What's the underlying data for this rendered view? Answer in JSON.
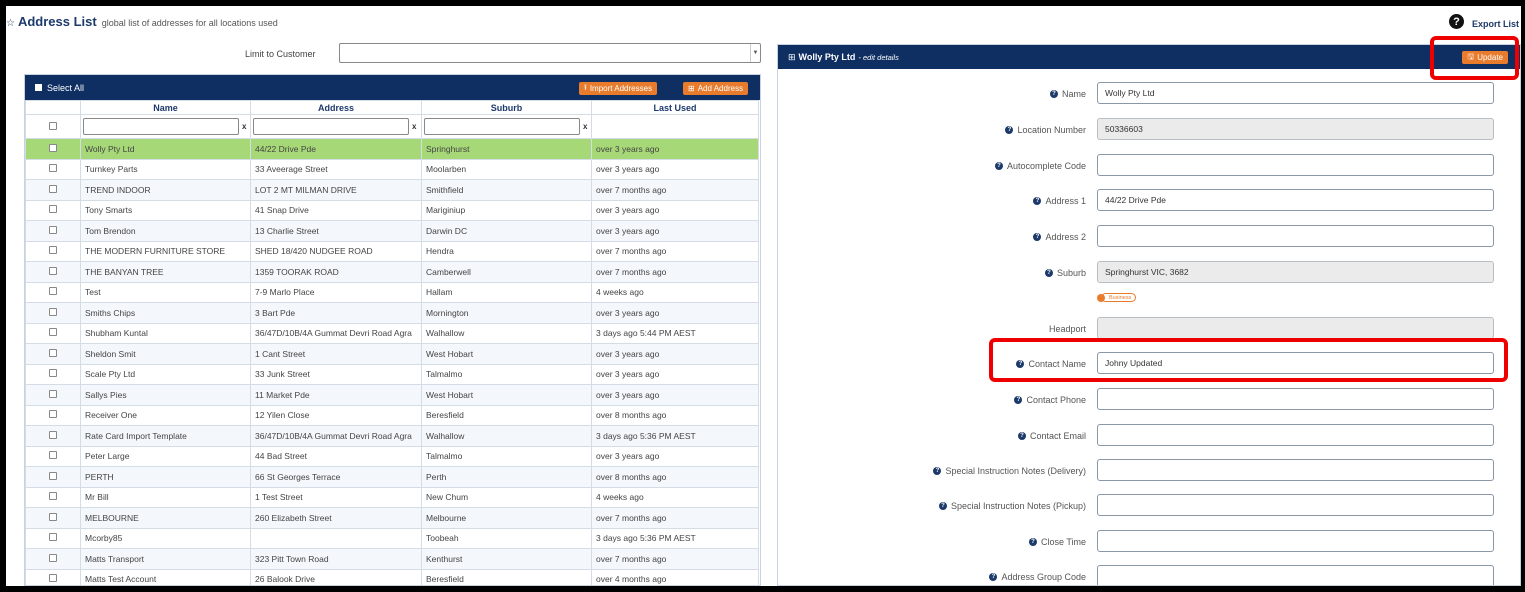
{
  "header": {
    "title": "Address List",
    "subtitle": "global list of addresses for all locations used",
    "export_label": "Export List"
  },
  "limit": {
    "label": "Limit to Customer",
    "value": ""
  },
  "list": {
    "select_all": "Select All",
    "import_label": "Import Addresses",
    "add_label": "Add Address",
    "columns": [
      "Name",
      "Address",
      "Suburb",
      "Last Used"
    ],
    "rows": [
      {
        "name": "Wolly Pty Ltd",
        "address": "44/22 Drive Pde",
        "suburb": "Springhurst",
        "last": "over 3 years ago"
      },
      {
        "name": "Turnkey Parts",
        "address": "33 Aveerage Street",
        "suburb": "Moolarben",
        "last": "over 3 years ago"
      },
      {
        "name": "TREND INDOOR",
        "address": "LOT 2 MT MILMAN DRIVE",
        "suburb": "Smithfield",
        "last": "over 7 months ago"
      },
      {
        "name": "Tony Smarts",
        "address": "41 Snap Drive",
        "suburb": "Mariginiup",
        "last": "over 3 years ago"
      },
      {
        "name": "Tom Brendon",
        "address": "13 Charlie Street",
        "suburb": "Darwin DC",
        "last": "over 3 years ago"
      },
      {
        "name": "THE MODERN FURNITURE STORE",
        "address": "SHED 18/420 NUDGEE ROAD",
        "suburb": "Hendra",
        "last": "over 7 months ago"
      },
      {
        "name": "THE BANYAN TREE",
        "address": "1359 TOORAK ROAD",
        "suburb": "Camberwell",
        "last": "over 7 months ago"
      },
      {
        "name": "Test",
        "address": "7-9 Marlo Place",
        "suburb": "Hallam",
        "last": "4 weeks ago"
      },
      {
        "name": "Smiths Chips",
        "address": "3 Bart Pde",
        "suburb": "Mornington",
        "last": "over 3 years ago"
      },
      {
        "name": "Shubham Kuntal",
        "address": "36/47D/10B/4A Gummat Devri Road Agra",
        "suburb": "Walhallow",
        "last": "3 days ago 5:44 PM AEST"
      },
      {
        "name": "Sheldon Smit",
        "address": "1 Cant Street",
        "suburb": "West Hobart",
        "last": "over 3 years ago"
      },
      {
        "name": "Scale Pty Ltd",
        "address": "33 Junk Street",
        "suburb": "Talmalmo",
        "last": "over 3 years ago"
      },
      {
        "name": "Sallys Pies",
        "address": "11 Market Pde",
        "suburb": "West Hobart",
        "last": "over 3 years ago"
      },
      {
        "name": "Receiver One",
        "address": "12 Yilen Close",
        "suburb": "Beresfield",
        "last": "over 8 months ago"
      },
      {
        "name": "Rate Card Import Template",
        "address": "36/47D/10B/4A Gummat Devri Road Agra",
        "suburb": "Walhallow",
        "last": "3 days ago 5:36 PM AEST"
      },
      {
        "name": "Peter Large",
        "address": "44 Bad Street",
        "suburb": "Talmalmo",
        "last": "over 3 years ago"
      },
      {
        "name": "PERTH",
        "address": "66 St Georges Terrace",
        "suburb": "Perth",
        "last": "over 8 months ago"
      },
      {
        "name": "Mr Bill",
        "address": "1 Test Street",
        "suburb": "New Chum",
        "last": "4 weeks ago"
      },
      {
        "name": "MELBOURNE",
        "address": "260 Elizabeth Street",
        "suburb": "Melbourne",
        "last": "over 7 months ago"
      },
      {
        "name": "Mcorby85",
        "address": "",
        "suburb": "Toobeah",
        "last": "3 days ago 5:36 PM AEST"
      },
      {
        "name": "Matts Transport",
        "address": "323 Pitt Town Road",
        "suburb": "Kenthurst",
        "last": "over 7 months ago"
      },
      {
        "name": "Matts Test Account",
        "address": "26 Balook Drive",
        "suburb": "Beresfield",
        "last": "over 4 months ago"
      }
    ]
  },
  "detail": {
    "title": "Wolly Pty Ltd",
    "subtitle": "- edit details",
    "update_label": "Update",
    "toggle_label": "Business",
    "fields": [
      {
        "label": "Name",
        "value": "Wolly Pty Ltd"
      },
      {
        "label": "Location Number",
        "value": "50336603"
      },
      {
        "label": "Autocomplete Code",
        "value": ""
      },
      {
        "label": "Address 1",
        "value": "44/22 Drive Pde"
      },
      {
        "label": "Address 2",
        "value": ""
      },
      {
        "label": "Suburb",
        "value": "Springhurst VIC, 3682"
      },
      {
        "label": "Headport",
        "value": ""
      },
      {
        "label": "Contact Name",
        "value": "Johny Updated"
      },
      {
        "label": "Contact Phone",
        "value": ""
      },
      {
        "label": "Contact Email",
        "value": ""
      },
      {
        "label": "Special Instruction Notes (Delivery)",
        "value": ""
      },
      {
        "label": "Special Instruction Notes (Pickup)",
        "value": ""
      },
      {
        "label": "Close Time",
        "value": ""
      },
      {
        "label": "Address Group Code",
        "value": ""
      }
    ]
  },
  "colors": {
    "navy": "#0f2f63",
    "orange": "#e97c2c",
    "selected_row": "#a6d878",
    "highlight": "#ee0000"
  },
  "icons": [
    "star-icon",
    "help-icon",
    "upload-icon",
    "plus-square-icon",
    "table-icon",
    "save-icon",
    "dropdown-arrow-icon"
  ]
}
